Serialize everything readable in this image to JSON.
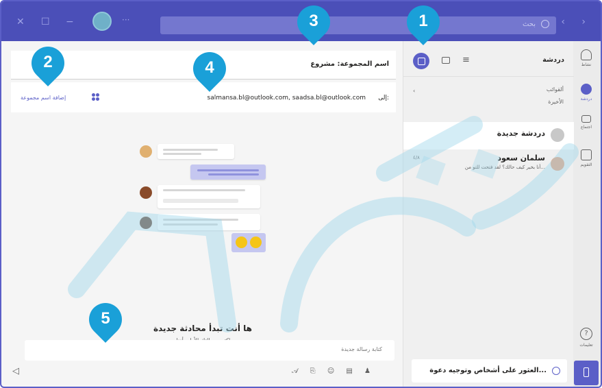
{
  "titlebar": {
    "search_placeholder": "بحث",
    "icons": [
      "close-icon",
      "maximize-icon",
      "minimize-icon",
      "avatar",
      "more-icon",
      "search-icon",
      "back-icon",
      "forward-icon"
    ]
  },
  "rail": {
    "items": [
      {
        "label": "نشاط",
        "icon": "bell-icon"
      },
      {
        "label": "دردشة",
        "icon": "chat-icon"
      },
      {
        "label": "اجتماع",
        "icon": "video-icon"
      },
      {
        "label": "التقويم",
        "icon": "calendar-icon"
      }
    ],
    "help_label": "تعليمات"
  },
  "chatlist": {
    "title": "دردشة",
    "pinned_label": "ألقوائب",
    "recent_label": "الأخيرة",
    "items": [
      {
        "name": "دردشة جديدة",
        "preview": "",
        "date": ""
      },
      {
        "name": "سلمان سعود",
        "preview": "أنا بخير كيف حالك؟ لقد فتحت للتو من...",
        "date": "٤/٨"
      }
    ],
    "invite_label": "العثور على أشخاص وتوجيه دعوة..."
  },
  "main": {
    "group_name_label": "اسم المجموعة: مشروع",
    "to_label": "إلى:",
    "to_value": "salmansa.bl@outlook.com, saadsa.bl@outlook.com",
    "add_group_label": "إضافة اسم مجموعة",
    "empty_title": "ها أنت تبدأ محادثة جديدة",
    "empty_subtitle": "اكتب رسالتك الأولى أدناه.",
    "composer_placeholder": "كتابة رسالة جديدة"
  },
  "callouts": [
    "1",
    "2",
    "3",
    "4",
    "5"
  ],
  "colors": {
    "accent": "#5b5fc7",
    "titlebar": "#4b4fb8",
    "callout": "#1aa0d8"
  }
}
